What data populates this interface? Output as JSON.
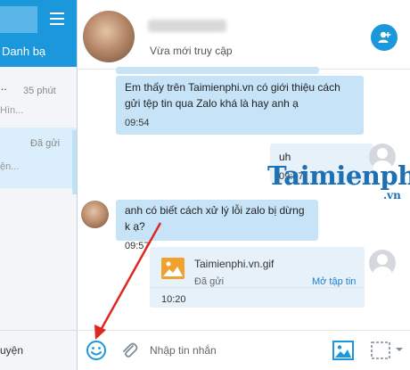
{
  "sidebar": {
    "contacts_label": "Danh bạ",
    "conversations": [
      {
        "prefix": "..",
        "time": "35 phút",
        "preview": "Hìn..."
      },
      {
        "status": "Đã gửi",
        "preview": "ện..."
      }
    ],
    "bottom_label": "uyện"
  },
  "header": {
    "contact_status": "Vừa mới truy cập"
  },
  "messages": [
    {
      "text": "Em thấy trên Taimienphi.vn có giới thiệu cách gửi tệp tin qua Zalo khá là hay anh ạ",
      "time": "09:54"
    },
    {
      "text": "uh",
      "time": "09:57"
    },
    {
      "text": "anh có biết cách xử lý lỗi zalo bị dừng k ạ?",
      "time": "09:57"
    }
  ],
  "file_message": {
    "name": "Taimienphi.vn.gif",
    "status": "Đã gửi",
    "action": "Mở tập tin",
    "time": "10:20"
  },
  "input": {
    "placeholder": "Nhập tin nhắn"
  },
  "watermark": {
    "text": "Taimienphi",
    "suffix": ".vn"
  },
  "colors": {
    "accent": "#1b98dc",
    "incoming_bubble": "#c7e3f7",
    "outgoing_bubble": "#e7f1fa",
    "annotation": "#e0261f",
    "watermark": "#1f6fb3"
  },
  "icons": [
    "menu-icon",
    "add-friend-icon",
    "emoji-icon",
    "attach-icon",
    "image-icon",
    "screenshot-icon",
    "file-image-icon",
    "contact-placeholder-icon"
  ]
}
